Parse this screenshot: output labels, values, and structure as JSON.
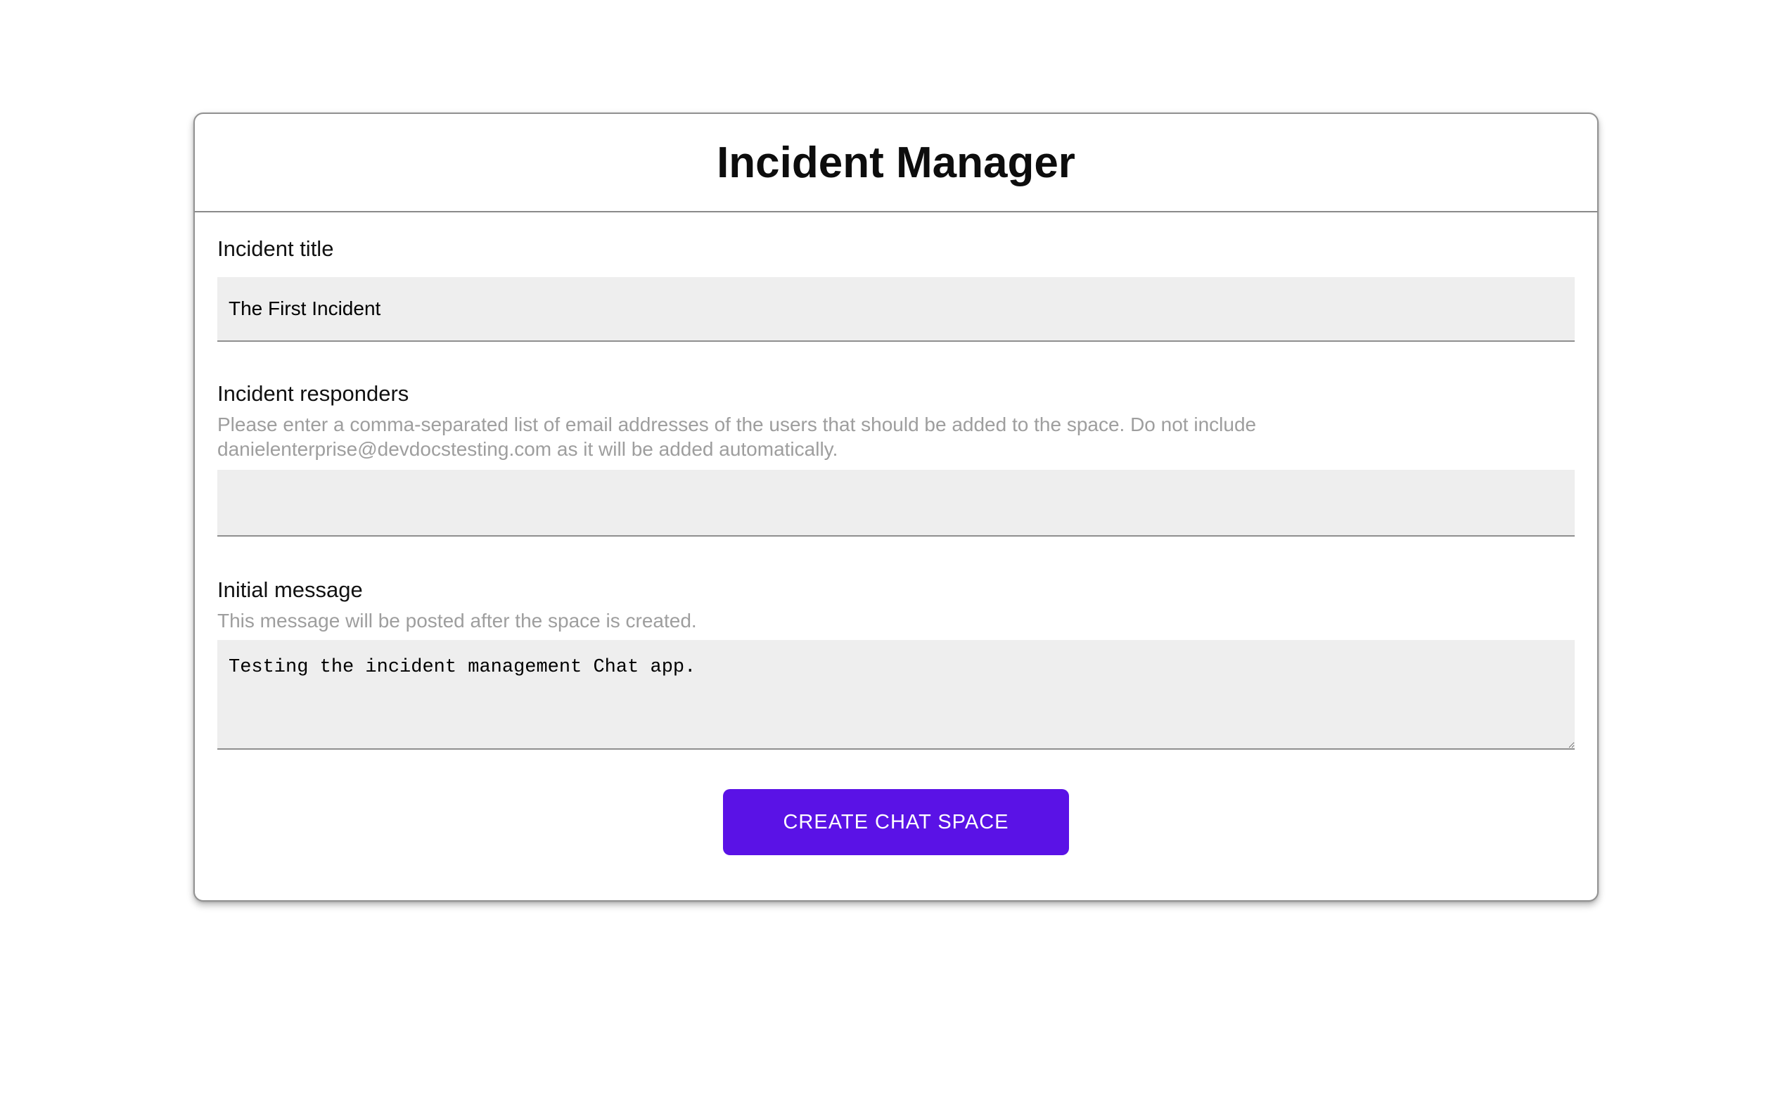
{
  "page": {
    "title": "Incident Manager"
  },
  "form": {
    "incident_title": {
      "label": "Incident title",
      "value": "The First Incident"
    },
    "incident_responders": {
      "label": "Incident responders",
      "hint": "Please enter a comma-separated list of email addresses of the users that should be added to the space. Do not include danielenterprise@devdocstesting.com as it will be added automatically.",
      "value": ""
    },
    "initial_message": {
      "label": "Initial message",
      "hint": "This message will be posted after the space is created.",
      "value": "Testing the incident management Chat app."
    },
    "submit_label": "CREATE CHAT SPACE"
  },
  "colors": {
    "accent": "#5a12e6",
    "input_bg": "#eeeeee",
    "underline": "#8f8f8f",
    "hint_text": "#9e9e9e",
    "card_border": "#919191"
  }
}
